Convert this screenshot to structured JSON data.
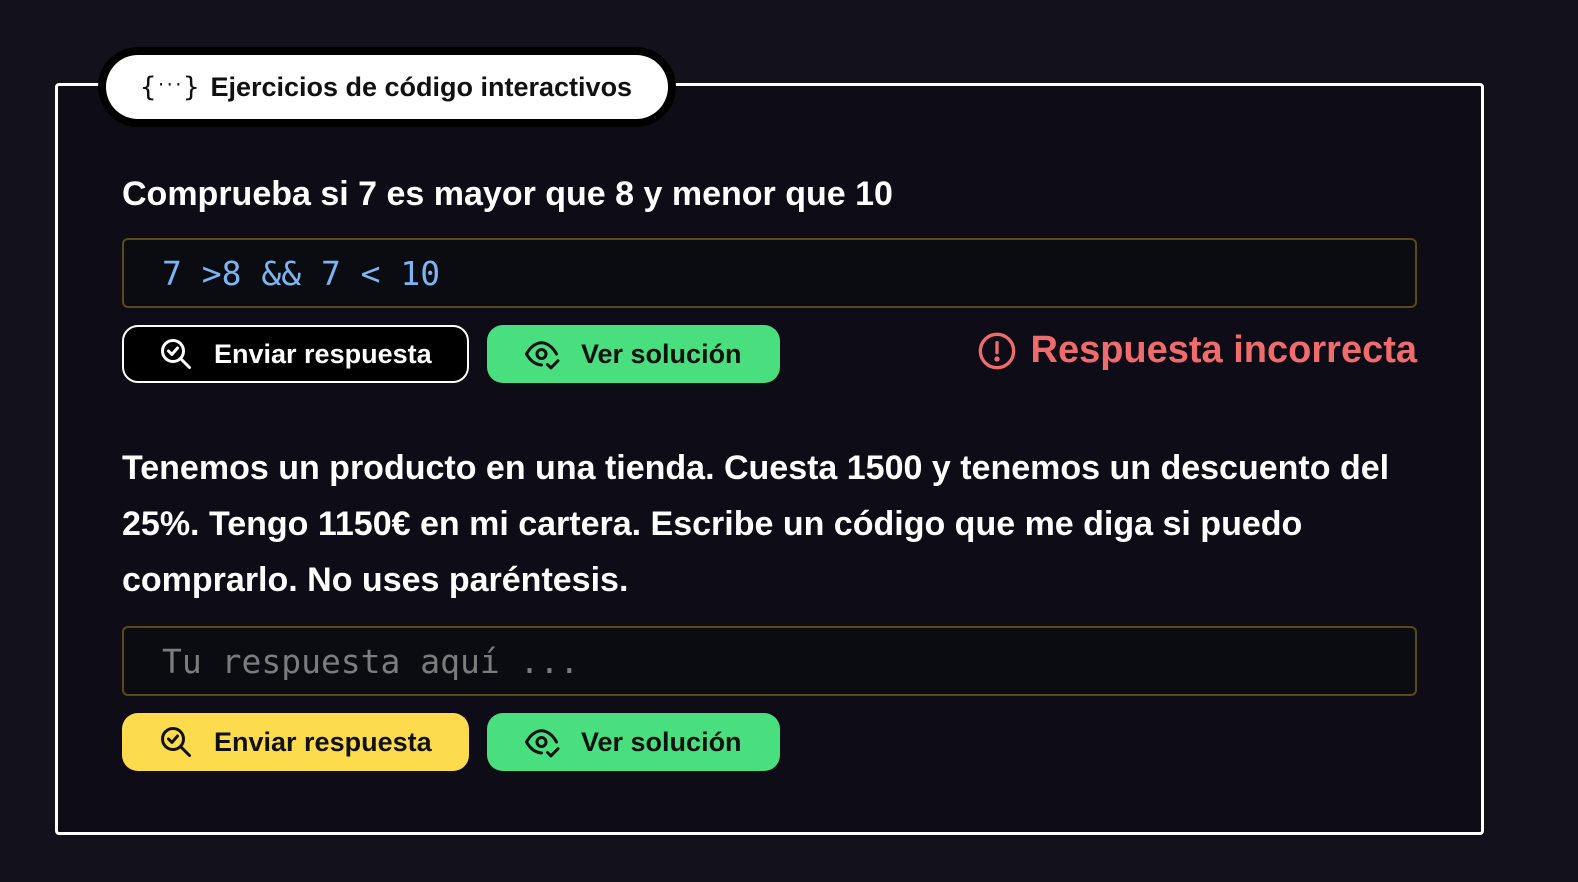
{
  "header": {
    "icon": "code-braces-icon",
    "title": "Ejercicios de código interactivos"
  },
  "exercises": [
    {
      "question": "Comprueba si 7 es mayor que 8 y menor que 10",
      "answer_value": "7 >8 && 7 < 10",
      "submit_label": "Enviar respuesta",
      "solution_label": "Ver solución",
      "feedback": "Respuesta incorrecta"
    },
    {
      "question": "Tenemos un producto en una tienda. Cuesta 1500 y tenemos un descuento del 25%. Tengo 1150€ en mi cartera. Escribe un código que me diga si puedo comprarlo. No uses paréntesis.",
      "answer_placeholder": "Tu respuesta aquí ...",
      "submit_label": "Enviar respuesta",
      "solution_label": "Ver solución"
    }
  ],
  "colors": {
    "background": "#12111c",
    "panel": "#0e0d17",
    "code_text": "#7ab6f2",
    "solution_button": "#49df7f",
    "submit_button_active": "#fcdc4d",
    "error": "#f06c6c",
    "input_border": "#5c4a14"
  }
}
